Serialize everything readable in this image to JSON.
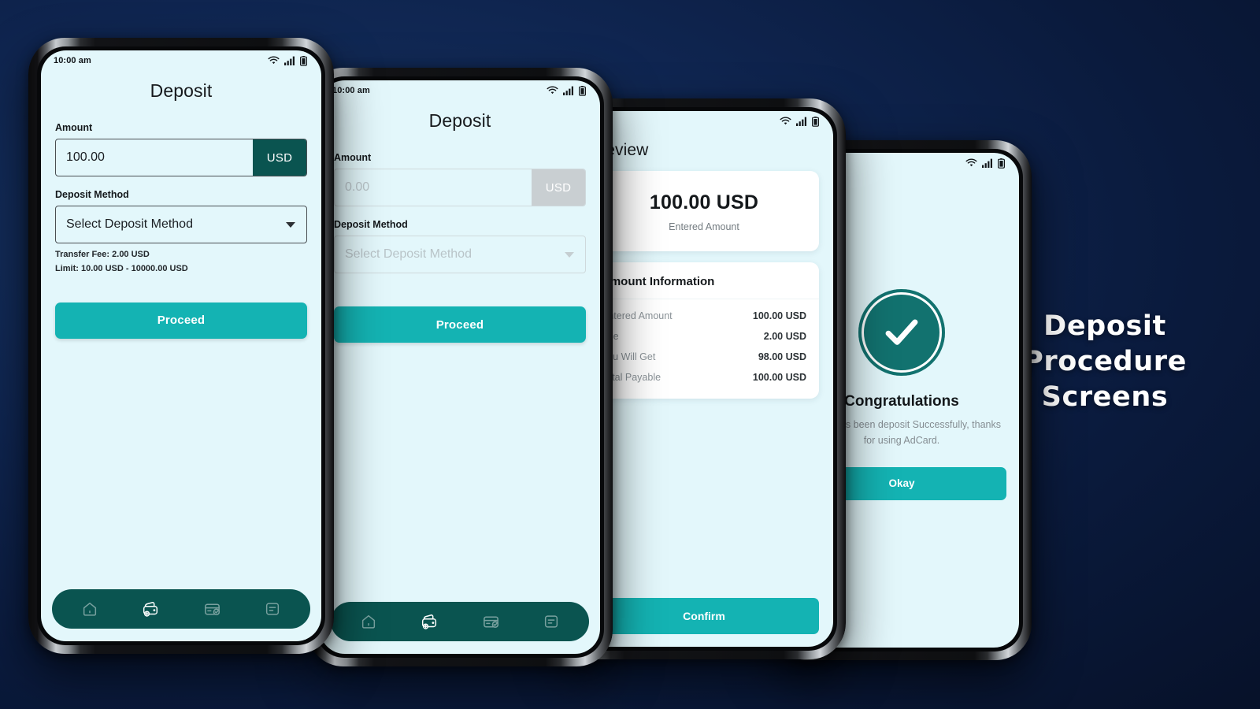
{
  "headline": {
    "line1": "Deposit",
    "line2": "Procedure Screens"
  },
  "colors": {
    "background_dark": "#0a1a3c",
    "screen_background": "#e3f7fb",
    "accent_teal": "#14b3b3",
    "dark_teal": "#0a5450",
    "success_teal": "#12726f",
    "card_white": "#ffffff"
  },
  "status_bar": {
    "time": "10:00 am",
    "icons": [
      "wifi-icon",
      "signal-icon",
      "battery-icon"
    ]
  },
  "bottom_nav": {
    "items": [
      {
        "icon": "home-icon",
        "active": false
      },
      {
        "icon": "wallet-icon",
        "active": true
      },
      {
        "icon": "card-check-icon",
        "active": false
      },
      {
        "icon": "statement-icon",
        "active": false
      }
    ]
  },
  "screens": {
    "deposit_filled": {
      "title": "Deposit",
      "amount_label": "Amount",
      "amount_value": "100.00",
      "currency": "USD",
      "method_label": "Deposit Method",
      "method_value": "Select Deposit Method",
      "transfer_fee": "Transfer Fee: 2.00 USD",
      "limit": "Limit: 10.00 USD - 10000.00 USD",
      "proceed_label": "Proceed"
    },
    "deposit_empty": {
      "title": "Deposit",
      "amount_label": "Amount",
      "amount_placeholder": "0.00",
      "currency": "USD",
      "method_label": "Deposit Method",
      "method_placeholder": "Select Deposit Method",
      "proceed_label": "Proceed"
    },
    "preview": {
      "title": "Preview",
      "amount_big": "100.00 USD",
      "amount_caption": "Entered Amount",
      "info_title": "Amount Information",
      "rows": [
        {
          "key": "Entered Amount",
          "value": "100.00 USD"
        },
        {
          "key": "Fee",
          "value": "2.00 USD"
        },
        {
          "key": "You Will Get",
          "value": "98.00 USD"
        },
        {
          "key": "Total Payable",
          "value": "100.00 USD"
        }
      ],
      "confirm_label": "Confirm"
    },
    "success": {
      "icon": "check-circle-icon",
      "title": "Congratulations",
      "message": "Money has been deposit Successfully, thanks for using AdCard.",
      "okay_label": "Okay"
    }
  }
}
